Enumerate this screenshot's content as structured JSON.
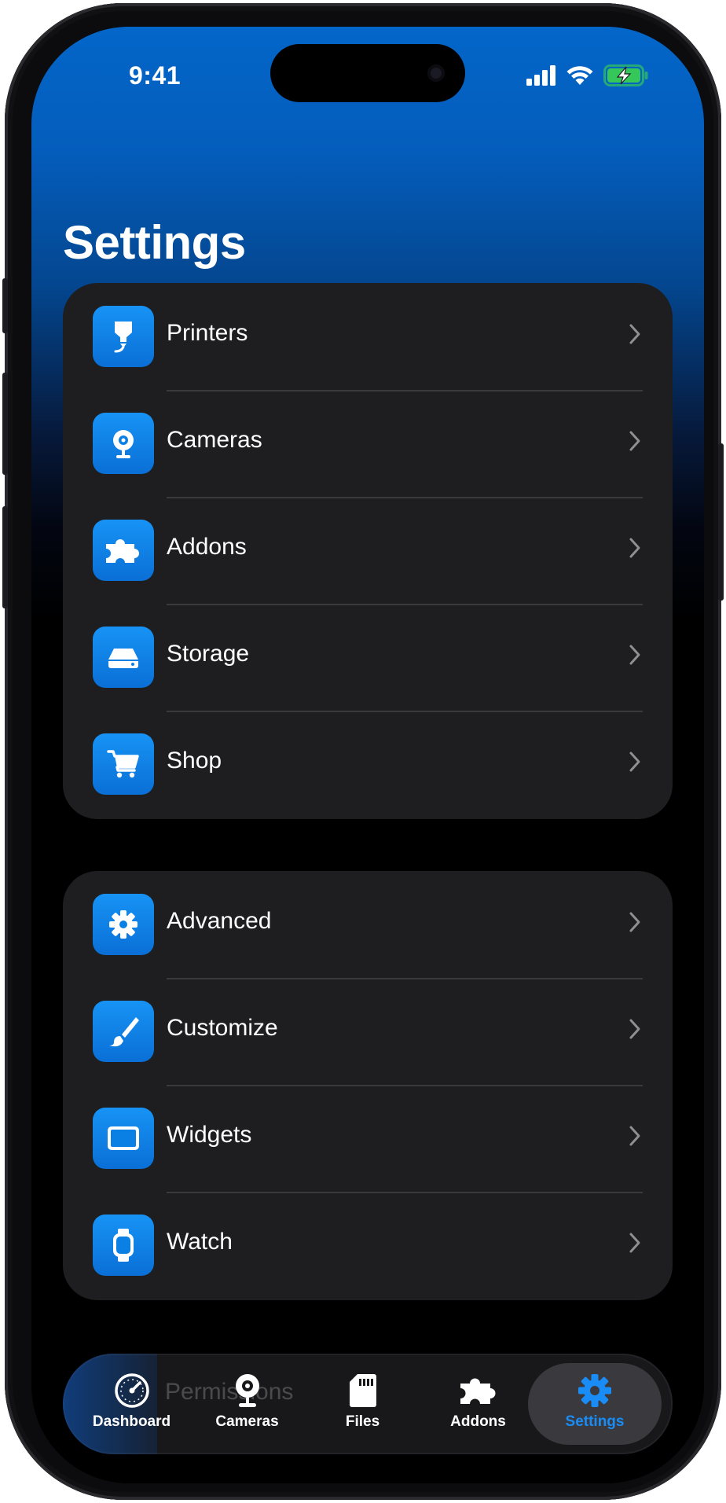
{
  "status_bar": {
    "time": "9:41"
  },
  "page": {
    "title": "Settings"
  },
  "groups": [
    {
      "items": [
        {
          "label": "Printers",
          "icon": "printer-icon"
        },
        {
          "label": "Cameras",
          "icon": "camera-icon"
        },
        {
          "label": "Addons",
          "icon": "puzzle-icon"
        },
        {
          "label": "Storage",
          "icon": "drive-icon"
        },
        {
          "label": "Shop",
          "icon": "cart-icon"
        }
      ]
    },
    {
      "items": [
        {
          "label": "Advanced",
          "icon": "gear-icon"
        },
        {
          "label": "Customize",
          "icon": "paintbrush-icon"
        },
        {
          "label": "Widgets",
          "icon": "widget-icon"
        },
        {
          "label": "Watch",
          "icon": "watch-icon"
        }
      ]
    }
  ],
  "behind_tabbar_text": "Permissions",
  "tabbar": {
    "tabs": [
      {
        "label": "Dashboard",
        "icon": "gauge-icon"
      },
      {
        "label": "Cameras",
        "icon": "camera-icon"
      },
      {
        "label": "Files",
        "icon": "sdcard-icon"
      },
      {
        "label": "Addons",
        "icon": "puzzle-icon"
      },
      {
        "label": "Settings",
        "icon": "gear-icon",
        "active": true
      }
    ]
  },
  "colors": {
    "accent": "#1a8cf5",
    "card": "#1e1e20",
    "header_blue": "#0366c9"
  }
}
